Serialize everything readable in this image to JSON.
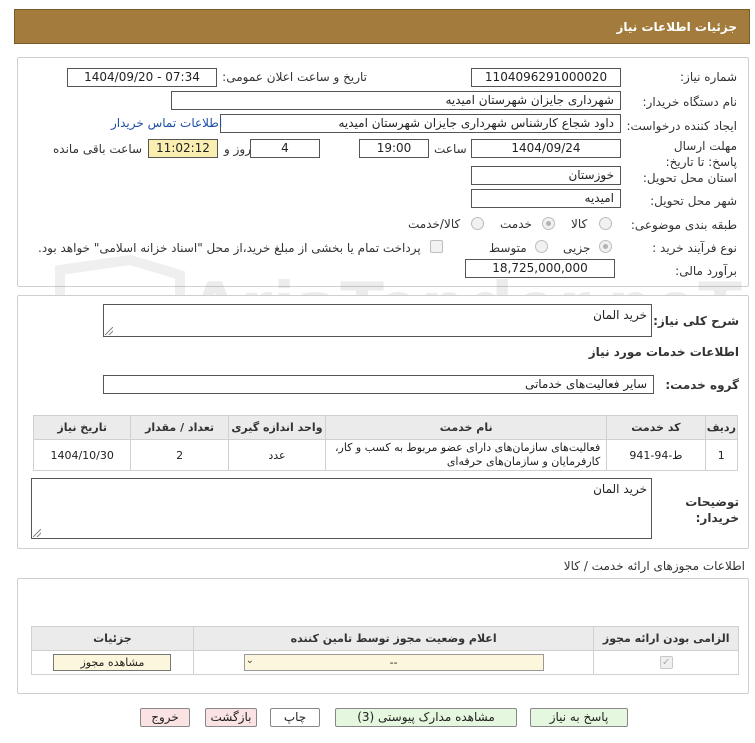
{
  "header": {
    "title": "جزئیات اطلاعات نیاز"
  },
  "watermark": {
    "text": "AriaTender.neT"
  },
  "form": {
    "need_number_label": "شماره نیاز:",
    "need_number": "1104096291000020",
    "announce_label": "تاریخ و ساعت اعلان عمومی:",
    "announce_value": "1404/09/20 - 07:34",
    "buyer_org_label": "نام دستگاه خریدار:",
    "buyer_org": "شهرداری جایزان شهرستان امیدیه",
    "creator_label": "ایجاد کننده درخواست:",
    "creator": "داود شجاع کارشناس شهرداری جایزان شهرستان امیدیه",
    "contact_link": "اطلاعات تماس خریدار",
    "deadline_label": "مهلت ارسال پاسخ: تا تاریخ:",
    "deadline_date": "1404/09/24",
    "time_label": "ساعت",
    "deadline_time": "19:00",
    "days_value": "4",
    "days_label": "روز و",
    "remaining_time": "11:02:12",
    "remaining_label": "ساعت باقی مانده",
    "province_label": "استان محل تحویل:",
    "province": "خوزستان",
    "city_label": "شهر محل تحویل:",
    "city": "امیدیه",
    "category_label": "طبقه بندی موضوعی:",
    "category_options": [
      "کالا",
      "خدمت",
      "کالا/خدمت"
    ],
    "category_selected": "خدمت",
    "process_label": "نوع فرآیند خرید :",
    "process_options": [
      "جزیی",
      "متوسط"
    ],
    "process_selected": "جزیی",
    "payment_note": "پرداخت تمام یا بخشی از مبلغ خرید،از محل \"اسناد خزانه اسلامی\" خواهد بود.",
    "budget_label": "برآورد مالی:",
    "budget": "18,725,000,000"
  },
  "summary": {
    "label": "شرح کلی نیاز:",
    "value": "خرید المان",
    "services_title": "اطلاعات خدمات مورد نیاز",
    "service_group_label": "گروه خدمت:",
    "service_group": "سایر فعالیت‌های خدماتی"
  },
  "services_table": {
    "headers": [
      "ردیف",
      "کد خدمت",
      "نام خدمت",
      "واحد اندازه گیری",
      "تعداد / مقدار",
      "تاریخ نیاز"
    ],
    "rows": [
      {
        "row": "1",
        "code": "ط-94-941",
        "name": "فعالیت‌های سازمان‌های دارای عضو مربوط به کسب و کار، کارفرمایان و سازمان‌های حرفه‌ای",
        "unit": "عدد",
        "qty": "2",
        "date": "1404/10/30"
      }
    ]
  },
  "buyer_notes": {
    "label": "توضیحات خریدار:",
    "value": "خرید المان"
  },
  "permits": {
    "title": "اطلاعات مجوزهای ارائه خدمت / کالا",
    "headers": [
      "الزامی بودن ارائه مجوز",
      "اعلام وضعیت مجوز توسط تامین کننده",
      "جزئیات"
    ],
    "select_value": "--",
    "view_button": "مشاهده مجوز"
  },
  "footer": {
    "reply": "پاسخ به نیاز",
    "attachments": "مشاهده مدارک پیوستی (3)",
    "print": "چاپ",
    "back": "بازگشت",
    "exit": "خروج"
  },
  "colors": {
    "header_bg": "#a37c3d",
    "remaining_bg": "#fbeeb1",
    "green_btn": "#e5f7df",
    "pink_btn": "#fbe3e3"
  }
}
